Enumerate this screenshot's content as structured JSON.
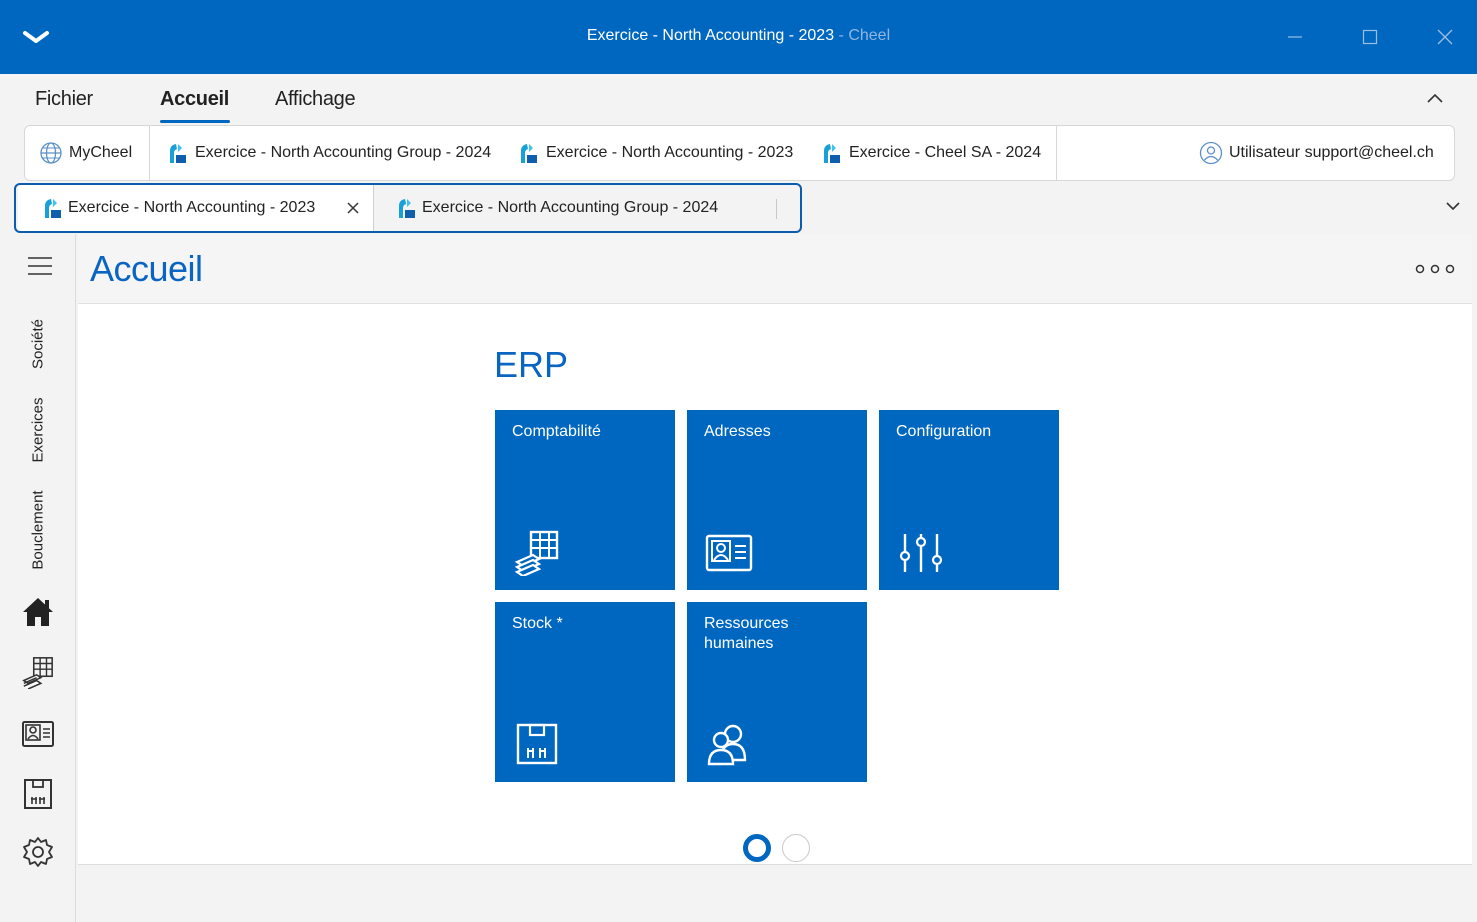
{
  "window": {
    "title_main": "Exercice - North Accounting - 2023",
    "title_sep": " - ",
    "title_app": "Cheel"
  },
  "ribbon": {
    "tabs": [
      {
        "label": "Fichier"
      },
      {
        "label": "Accueil",
        "active": true
      },
      {
        "label": "Affichage"
      }
    ]
  },
  "quickbar": {
    "items": [
      {
        "label": "MyCheel",
        "icon": "globe-icon"
      },
      {
        "label": "Exercice - North Accounting Group - 2024",
        "icon": "exercice-icon"
      },
      {
        "label": "Exercice - North Accounting - 2023",
        "icon": "exercice-icon"
      },
      {
        "label": "Exercice - Cheel SA - 2024",
        "icon": "exercice-icon"
      }
    ],
    "user": {
      "label": "Utilisateur support@cheel.ch",
      "icon": "user-icon"
    }
  },
  "doc_tabs": [
    {
      "label": "Exercice - North Accounting - 2023",
      "active": true
    },
    {
      "label": "Exercice - North Accounting Group - 2024",
      "active": false
    }
  ],
  "leftnav": {
    "vertical_labels": [
      "Société",
      "Exercices",
      "Bouclement"
    ],
    "icons": [
      "home-icon",
      "accounting-icon",
      "address-card-icon",
      "stock-box-icon",
      "settings-icon"
    ]
  },
  "page": {
    "title": "Accueil",
    "section_title": "ERP",
    "tiles": [
      {
        "label": "Comptabilité",
        "icon": "accounting-icon"
      },
      {
        "label": "Adresses",
        "icon": "address-card-icon"
      },
      {
        "label": "Configuration",
        "icon": "sliders-icon"
      },
      {
        "label": "Stock *",
        "icon": "stock-box-icon"
      },
      {
        "label": "Ressources humaines",
        "icon": "people-icon"
      }
    ],
    "pagination": {
      "current": 1,
      "total": 2
    }
  },
  "colors": {
    "accent": "#0067c0",
    "title_blue": "#0a64c1",
    "background": "#f3f3f3"
  }
}
